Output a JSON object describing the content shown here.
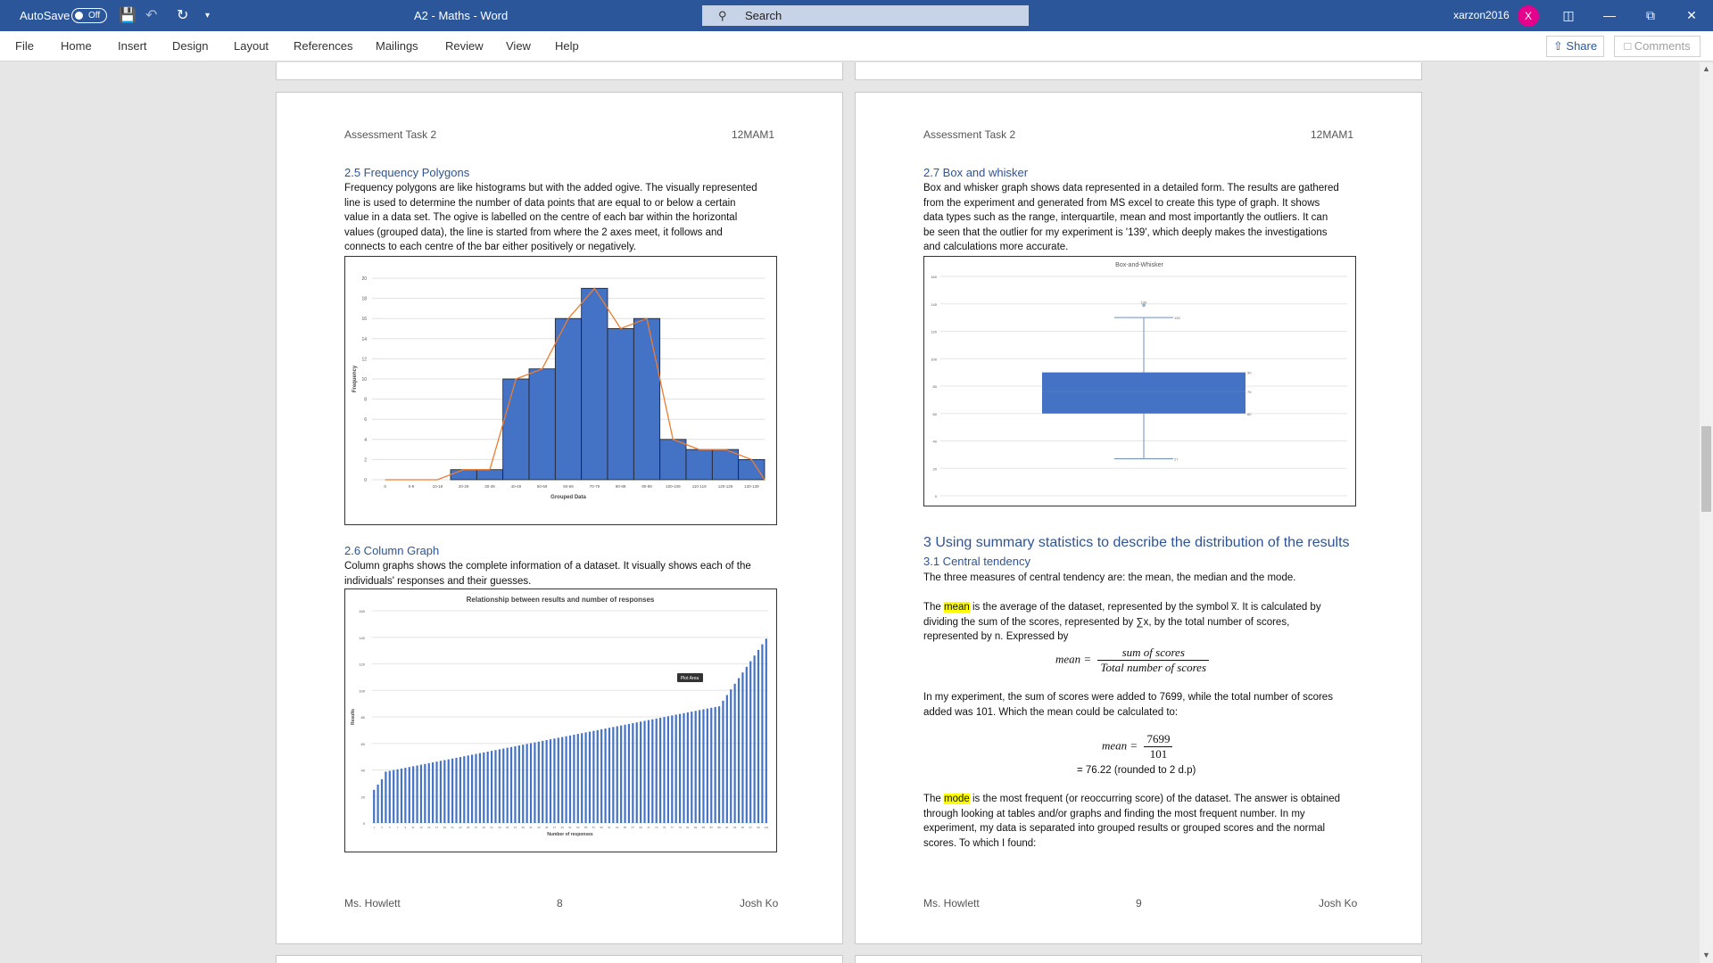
{
  "titlebar": {
    "autosave": "AutoSave",
    "autosave_state": "Off",
    "doc_title": "A2 - Maths - Word",
    "search_placeholder": "Search",
    "username": "xarzon2016",
    "avatar_initial": "X"
  },
  "menu": {
    "items": [
      "File",
      "Home",
      "Insert",
      "Design",
      "Layout",
      "References",
      "Mailings",
      "Review",
      "View",
      "Help"
    ],
    "share": "Share",
    "comments": "Comments"
  },
  "page8": {
    "header_left": "Assessment Task 2",
    "header_right": "12MAM1",
    "sec1_title": "2.5 Frequency Polygons",
    "sec1_lines": [
      "Frequency polygons are like histograms but with the added ogive. The visually represented",
      "line is used to determine the number of data points that are equal to or below a certain",
      "value in a data set. The ogive is labelled on the centre of each bar within the horizontal",
      "values (grouped data), the line is started from where the 2 axes meet, it follows and",
      "connects to each centre of the bar either positively or negatively."
    ],
    "sec2_title": "2.6 Column Graph",
    "sec2_lines": [
      "Column graphs shows the complete information of a dataset. It visually shows each of the",
      "individuals' responses and their guesses."
    ],
    "footer_left": "Ms. Howlett",
    "footer_center": "8",
    "footer_right": "Josh Ko"
  },
  "page9": {
    "header_left": "Assessment Task 2",
    "header_right": "12MAM1",
    "sec1_title": "2.7 Box and whisker",
    "sec1_lines": [
      "Box and whisker graph shows data represented in a detailed form. The results are gathered",
      "from the experiment and generated from MS excel to create this type of graph. It shows",
      "data types such as the range, interquartile, mean and most importantly the outliers. It can",
      "be seen that the outlier for my experiment is '139', which deeply makes the investigations",
      "and calculations more accurate."
    ],
    "sec2_title": "3 Using summary statistics to describe the distribution of the results",
    "sec3_title": "3.1 Central tendency",
    "p1": "The three measures of central tendency are: the mean, the median and the mode.",
    "p2_a": "The ",
    "p2_hl": "mean",
    "p2_b": " is the average of the dataset, represented by the symbol x̅. It is calculated by",
    "p2_line2": "dividing the sum of the scores, represented by ∑x, by the total number of scores,",
    "p2_line3": "represented by n. Expressed by",
    "formula1_lhs": "mean =",
    "formula1_num": "sum of scores",
    "formula1_den": "Total number of scores",
    "p3_line1": "In my experiment, the sum of scores were added to 7699, while the total number of scores",
    "p3_line2": "added was 101. Which the mean could be calculated to:",
    "formula2_lhs": "mean =",
    "formula2_num": "7699",
    "formula2_den": "101",
    "formula2_result": "= 76.22 (rounded to 2 d.p)",
    "p4_a": "The ",
    "p4_hl": "mode",
    "p4_b": " is the most frequent (or reoccurring score) of the dataset. The answer is obtained",
    "p4_lines": [
      "through looking at tables and/or graphs and finding the most frequent number. In my",
      "experiment, my data is separated into grouped results or grouped scores and the normal",
      "scores. To which I found:"
    ],
    "footer_left": "Ms. Howlett",
    "footer_center": "9",
    "footer_right": "Josh Ko"
  },
  "chart_data": [
    {
      "type": "bar",
      "title": "",
      "xlabel": "Grouped Data",
      "ylabel": "Frequency",
      "ylim": [
        0,
        20
      ],
      "yticks": [
        0,
        2,
        4,
        6,
        8,
        10,
        12,
        14,
        16,
        18,
        20
      ],
      "categories": [
        "0",
        "0-9",
        "10-19",
        "20-29",
        "30-39",
        "40-49",
        "50-59",
        "60-69",
        "70-79",
        "80-89",
        "90-99",
        "100-109",
        "110-119",
        "120-129",
        "130-139"
      ],
      "values": [
        0,
        0,
        0,
        1,
        1,
        10,
        11,
        16,
        19,
        15,
        16,
        4,
        3,
        3,
        2
      ],
      "polygon": "frequency polygon line connecting bar centres",
      "colors": {
        "bar": "#4472c4",
        "line": "#ed7d31"
      }
    },
    {
      "type": "bar",
      "title": "Relationship between results and number of responses",
      "xlabel": "Number of responses",
      "ylabel": "Results",
      "ylim": [
        0,
        160
      ],
      "yticks": [
        0,
        20,
        40,
        60,
        80,
        100,
        120,
        140,
        160
      ],
      "n": 101,
      "annotation": "Plot Area",
      "values_desc": "sorted ascending from about 25 to 139",
      "color": "#4472c4"
    },
    {
      "type": "box",
      "title": "Box-and-Whisker",
      "ylim": [
        0,
        160
      ],
      "yticks": [
        0,
        20,
        40,
        60,
        80,
        100,
        120,
        140,
        160
      ],
      "min": 27,
      "q1": 60,
      "median": 76,
      "q3": 90,
      "max": 130,
      "outlier": 139,
      "color": "#4472c4"
    }
  ]
}
